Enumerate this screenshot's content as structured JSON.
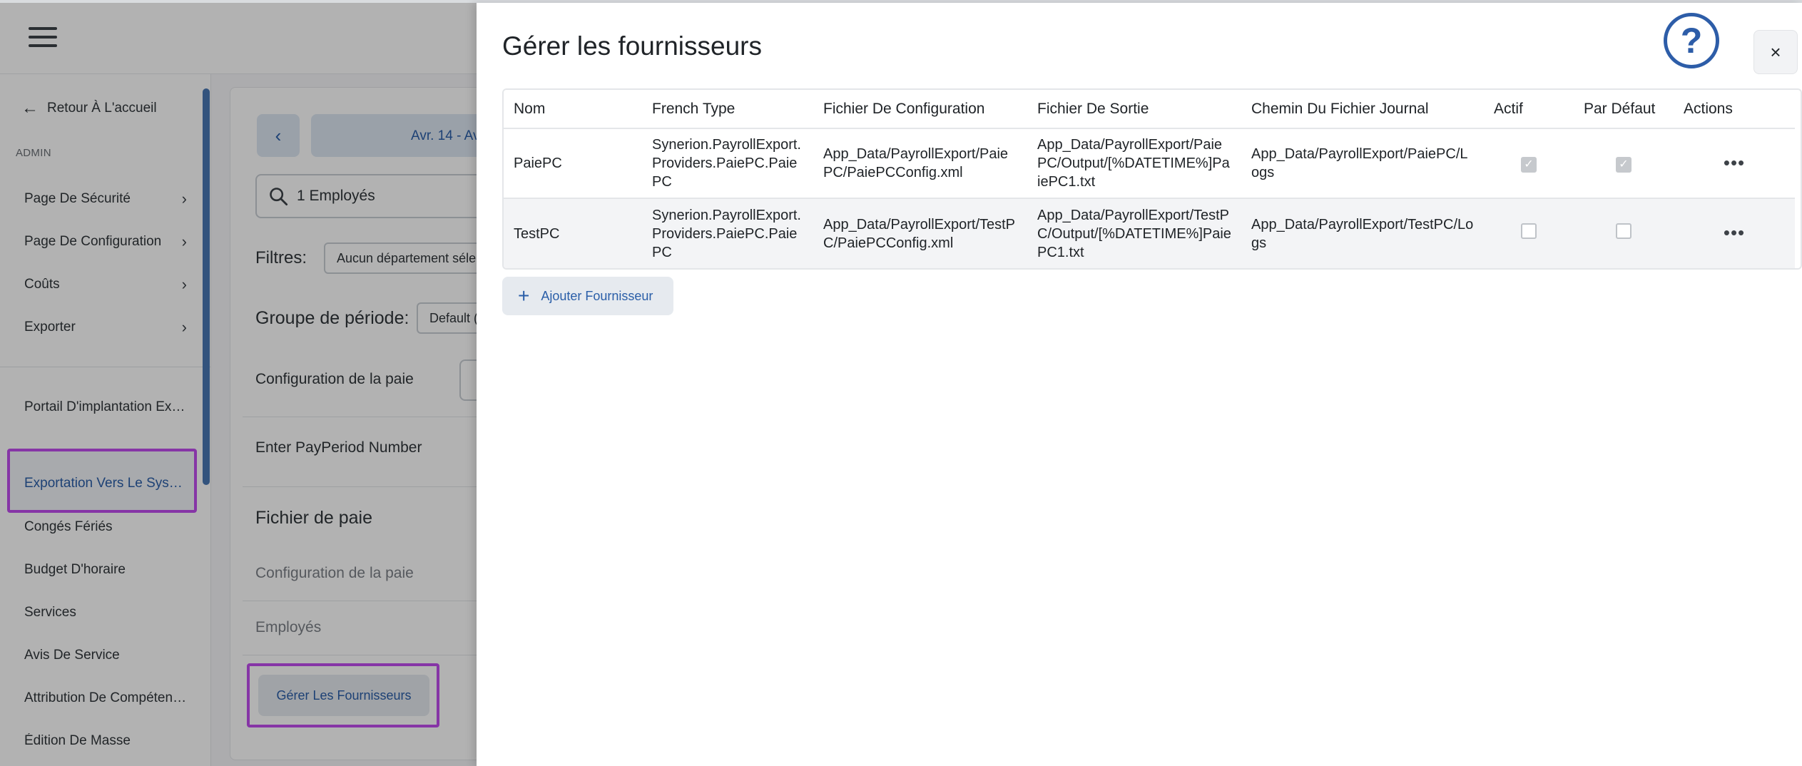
{
  "sidebar": {
    "back_label": "Retour À L'accueil",
    "section_label": "ADMIN",
    "items": [
      {
        "label": "Page De Sécurité"
      },
      {
        "label": "Page De Configuration"
      },
      {
        "label": "Coûts"
      },
      {
        "label": "Exporter"
      }
    ],
    "links": [
      {
        "label": "Portail D'implantation Expr..."
      },
      {
        "label": "Exportation Vers Le Systè..."
      },
      {
        "label": "Congés Fériés"
      },
      {
        "label": "Budget D'horaire"
      },
      {
        "label": "Services"
      },
      {
        "label": "Avis De Service"
      },
      {
        "label": "Attribution De Compétences"
      },
      {
        "label": "Édition De Masse"
      }
    ]
  },
  "main": {
    "period_label": "Avr. 14 - Av",
    "search_value": "1 Employés",
    "filters_label": "Filtres:",
    "filter_dept": "Aucun département séle",
    "group_label": "Groupe de période:",
    "group_value": "Default (",
    "payroll_config_label": "Configuration de la paie",
    "pay_period_label": "Enter PayPeriod Number",
    "pay_file_heading": "Fichier de paie",
    "pay_file_config": "Configuration de la paie",
    "pay_file_employees": "Employés",
    "manage_button": "Gérer Les Fournisseurs"
  },
  "modal": {
    "title": "Gérer les fournisseurs",
    "help_symbol": "?",
    "close_symbol": "×",
    "columns": {
      "nom": "Nom",
      "type": "French Type",
      "config": "Fichier De Configuration",
      "output": "Fichier De Sortie",
      "log": "Chemin Du Fichier Journal",
      "active": "Actif",
      "default": "Par Défaut",
      "actions": "Actions"
    },
    "rows": [
      {
        "nom": "PaiePC",
        "type": "Synerion.PayrollExport.Providers.PaiePC.PaiePC",
        "config": "App_Data/PayrollExport/PaiePC/PaiePCConfig.xml",
        "output": "App_Data/PayrollExport/PaiePC/Output/[%DATETIME%]PaiePC1.txt",
        "log": "App_Data/PayrollExport/PaiePC/Logs",
        "active": true,
        "default": true,
        "actions_symbol": "•••"
      },
      {
        "nom": "TestPC",
        "type": "Synerion.PayrollExport.Providers.PaiePC.PaiePC",
        "config": "App_Data/PayrollExport/TestPC/PaiePCConfig.xml",
        "output": "App_Data/PayrollExport/TestPC/Output/[%DATETIME%]PaiePC1.txt",
        "log": "App_Data/PayrollExport/TestPC/Logs",
        "active": false,
        "default": false,
        "actions_symbol": "•••"
      }
    ],
    "add_button": "Ajouter Fournisseur"
  },
  "colors": {
    "accent": "#2a5ea8",
    "highlight": "#c04dee"
  }
}
